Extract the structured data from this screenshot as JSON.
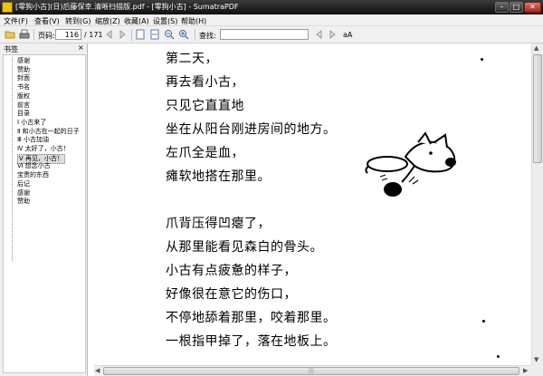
{
  "window": {
    "title": "[零狗小古](日)后藤保幸.清晰扫描版.pdf - [零狗小古] - SumatraPDF",
    "minimize": "–",
    "maximize": "□",
    "close": "✕"
  },
  "menu": [
    "文件(F)",
    "查看(V)",
    "转到(G)",
    "缩放(Z)",
    "收藏(A)",
    "设置(S)",
    "帮助(H)"
  ],
  "toolbar": {
    "page_label": "页码:",
    "page_value": "116",
    "page_total": "/ 171",
    "find_label": "查找:",
    "find_value": "",
    "match_case": "aA"
  },
  "sidebar": {
    "title": "书签",
    "close": "×",
    "items": [
      {
        "label": "感谢",
        "selected": false
      },
      {
        "label": "赞助",
        "selected": false
      },
      {
        "label": "封面",
        "selected": false
      },
      {
        "label": "书名",
        "selected": false
      },
      {
        "label": "版权",
        "selected": false
      },
      {
        "label": "前言",
        "selected": false
      },
      {
        "label": "目录",
        "selected": false
      },
      {
        "label": "Ⅰ 小古来了",
        "selected": false
      },
      {
        "label": "Ⅱ 和小古在一起的日子",
        "selected": false
      },
      {
        "label": "Ⅲ 小古加油",
        "selected": false
      },
      {
        "label": "Ⅳ 太好了，小古！",
        "selected": false
      },
      {
        "label": "Ⅴ 再见，小古！",
        "selected": true
      },
      {
        "label": "Ⅵ 想念小古",
        "selected": false
      },
      {
        "label": "宝贵的东西",
        "selected": false
      },
      {
        "label": "后记",
        "selected": false
      },
      {
        "label": "感谢",
        "selected": false
      },
      {
        "label": "赞助",
        "selected": false
      }
    ]
  },
  "document": {
    "lines": [
      "第二天，",
      "再去看小古，",
      "只见它直直地",
      "坐在从阳台刚进房间的地方。",
      "左爪全是血，",
      "瘫软地搭在那里。",
      "",
      "爪背压得凹瘪了，",
      "从那里能看见森白的骨头。",
      "小古有点疲惫的样子，",
      "好像很在意它的伤口，",
      "不停地舔着那里，咬着那里。",
      "一根指甲掉了，落在地板上。"
    ]
  }
}
